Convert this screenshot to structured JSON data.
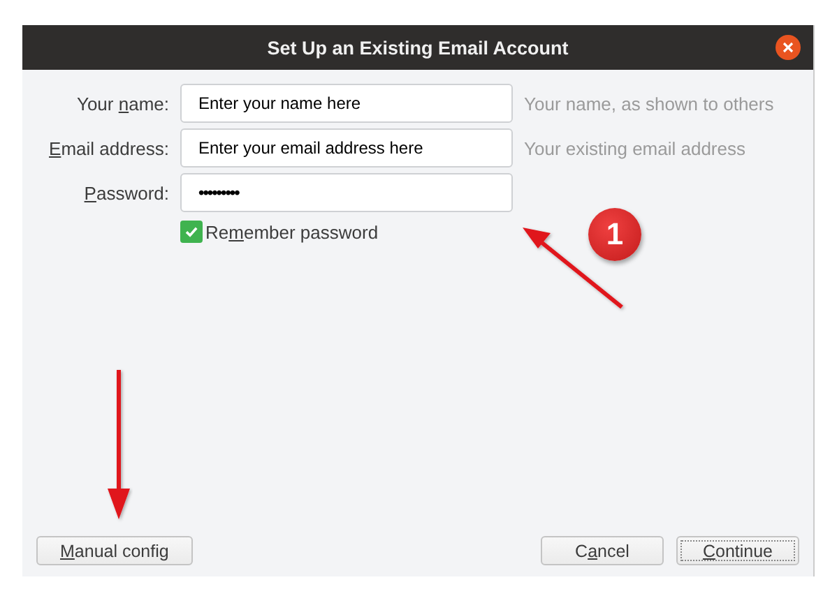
{
  "window": {
    "title": "Set Up an Existing Email Account"
  },
  "fields": [
    {
      "label": {
        "pre": "Your ",
        "key": "n",
        "post": "ame:"
      },
      "value": "Enter your name here",
      "hint": "Your name, as shown to others",
      "kind": "text"
    },
    {
      "label": {
        "key": "E",
        "post": "mail address:"
      },
      "value": "Enter your email address here",
      "hint": "Your existing email address",
      "kind": "text"
    },
    {
      "label": {
        "key": "P",
        "post": "assword:"
      },
      "value": "•••••••••",
      "kind": "password"
    }
  ],
  "remember": {
    "label": {
      "pre": "Re",
      "key": "m",
      "post": "ember password"
    },
    "checked": true
  },
  "buttons": [
    {
      "label": {
        "key": "M",
        "post": "anual config"
      },
      "kind": "left",
      "default": false
    },
    {
      "label": {
        "pre": "C",
        "key": "a",
        "post": "ncel"
      },
      "kind": "right",
      "default": false
    },
    {
      "label": {
        "key": "C",
        "post": "ontinue"
      },
      "kind": "right",
      "default": true
    }
  ],
  "annotations": [
    {
      "badge": "1"
    }
  ]
}
